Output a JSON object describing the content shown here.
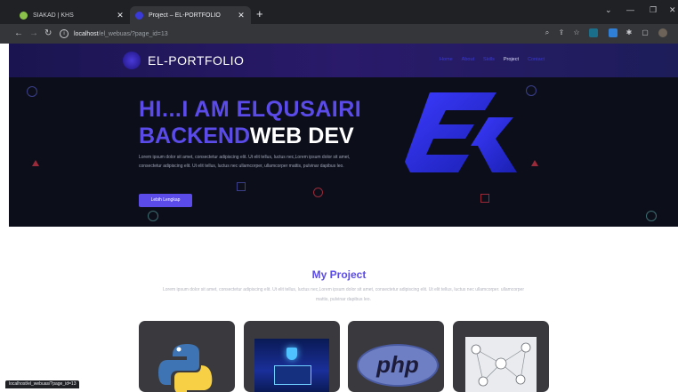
{
  "browser": {
    "tabs": [
      {
        "title": "SIAKAD | KHS",
        "active": false
      },
      {
        "title": "Project – EL-PORTFOLIO",
        "active": true
      }
    ],
    "url": {
      "host": "localhost",
      "path": "/el_webuas/?page_id=13"
    },
    "colors": {
      "tab_strip": "#1f2124",
      "toolbar": "#35363a"
    }
  },
  "site": {
    "brand": "EL-PORTFOLIO",
    "nav": [
      "Home",
      "About",
      "Skills",
      "Project",
      "Contact"
    ],
    "current_nav": "Project"
  },
  "hero": {
    "title_line1": "HI...I AM ELQUSAIRI",
    "title_line2_accent": "BACKEND",
    "title_line2_rest": "WEB DEV",
    "description": "Lorem ipsum dolor sit amet, consectetur adipiscing elit. Ut elit tellus, luctus nec,Lorem ipsum dolor sit amet, consectetur adipiscing elit. Ut elit tellus, luctus nec ullamcorper, ullamcorper mattis, pulvinar dapibus leo.",
    "button_label": "Lebih Lengkap"
  },
  "projects": {
    "title": "My Project",
    "description": "Lorem ipsum dolor sit amet, consectetur adipiscing elit. Ut elit tellus, luctus nec,Lorem ipsum dolor sit amet, consectetur adipiscing elit. Ut elit tellus, luctus nec ullamcorper. ullamcorper mattis, pulvinar dapibus leo.",
    "cards": [
      {
        "image": "python-logo"
      },
      {
        "image": "cyber-security-laptop"
      },
      {
        "image": "php-logo",
        "logo_text": "php"
      },
      {
        "image": "network-diagram"
      }
    ]
  },
  "status_bar": {
    "url": "localhost/el_webuas/?page_id=13"
  },
  "colors": {
    "accent": "#5b4be8",
    "hero_bg": "#0c0f1a",
    "nav_bg": "#2a1a6a",
    "card_bg": "#3a3a3e"
  }
}
